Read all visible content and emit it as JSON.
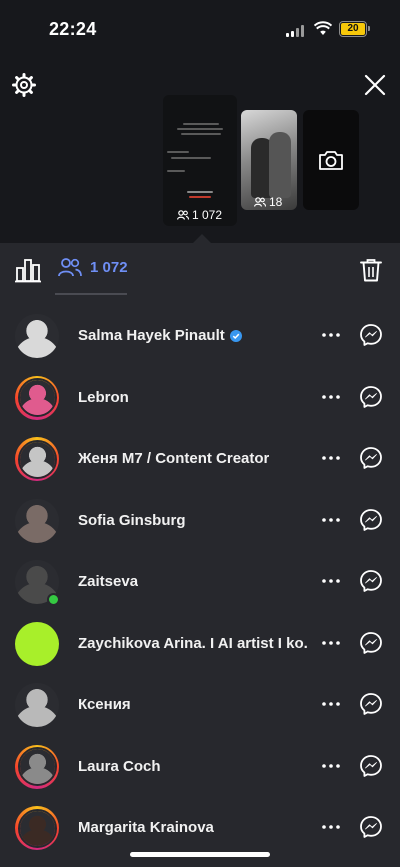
{
  "status_bar": {
    "time": "22:24",
    "battery": "20"
  },
  "story_viewer_count": "1 072",
  "second_story_count": "18",
  "tabs": {
    "viewers_count": "1 072"
  },
  "colors": {
    "accent": "#6f8ff5",
    "background": "#27282d",
    "online": "#35c942",
    "verified": "#3897f0"
  },
  "viewers": [
    {
      "name": "Salma Hayek Pinault",
      "verified": true,
      "ring": false,
      "online": false,
      "avatar_color": "#d9d9d9"
    },
    {
      "name": "Lebron",
      "verified": false,
      "ring": true,
      "online": false,
      "avatar_color": "#e05b8e"
    },
    {
      "name": "Женя M7 / Content Creator",
      "verified": false,
      "ring": true,
      "online": false,
      "avatar_color": "#c5c5c5"
    },
    {
      "name": "Sofia Ginsburg",
      "verified": false,
      "ring": false,
      "online": false,
      "avatar_color": "#7a6b66"
    },
    {
      "name": "Zaitseva",
      "verified": false,
      "ring": false,
      "online": true,
      "avatar_color": "#4a4a4a"
    },
    {
      "name": "Zaychikova Arina. I AI artist I ko...",
      "verified": false,
      "ring": false,
      "online": false,
      "avatar_color": "#a8ef2a"
    },
    {
      "name": "Ксения",
      "verified": false,
      "ring": false,
      "online": false,
      "avatar_color": "#b9b9b9"
    },
    {
      "name": "Laura Coch",
      "verified": false,
      "ring": true,
      "online": false,
      "avatar_color": "#8a8a8a"
    },
    {
      "name": "Margarita Krainova",
      "verified": false,
      "ring": true,
      "online": false,
      "avatar_color": "#3b2a24"
    }
  ]
}
